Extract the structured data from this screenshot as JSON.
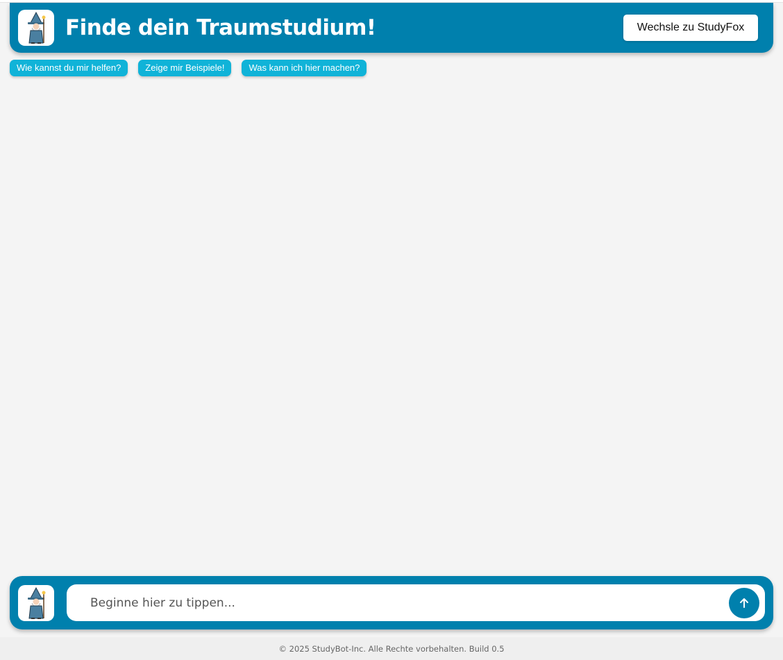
{
  "header": {
    "title": "Finde dein Traumstudium!",
    "switch_button_label": "Wechsle zu StudyFox",
    "avatar_icon": "wizard-icon"
  },
  "suggestions": [
    {
      "label": "Wie kannst du mir helfen?"
    },
    {
      "label": "Zeige mir Beispiele!"
    },
    {
      "label": "Was kann ich hier machen?"
    }
  ],
  "composer": {
    "placeholder": "Beginne hier zu tippen...",
    "send_icon": "arrow-up-icon",
    "avatar_icon": "wizard-icon"
  },
  "footer": {
    "text": "© 2025 StudyBot-Inc. Alle Rechte vorbehalten. Build 0.5"
  },
  "colors": {
    "primary": "#0080ad",
    "chip": "#10b3d8",
    "background": "#f4f4f4",
    "footer_background": "#efefef"
  }
}
